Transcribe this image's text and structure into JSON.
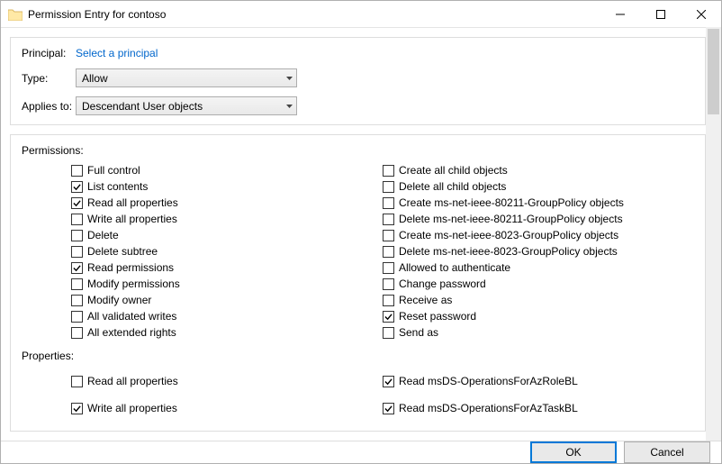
{
  "window": {
    "title": "Permission Entry for contoso"
  },
  "header": {
    "principal_label": "Principal:",
    "principal_link": "Select a principal",
    "type_label": "Type:",
    "type_value": "Allow",
    "applies_label": "Applies to:",
    "applies_value": "Descendant User objects"
  },
  "permissions_label": "Permissions:",
  "perms_left": [
    {
      "label": "Full control",
      "checked": false
    },
    {
      "label": "List contents",
      "checked": true
    },
    {
      "label": "Read all properties",
      "checked": true
    },
    {
      "label": "Write all properties",
      "checked": false
    },
    {
      "label": "Delete",
      "checked": false
    },
    {
      "label": "Delete subtree",
      "checked": false
    },
    {
      "label": "Read permissions",
      "checked": true
    },
    {
      "label": "Modify permissions",
      "checked": false
    },
    {
      "label": "Modify owner",
      "checked": false
    },
    {
      "label": "All validated writes",
      "checked": false
    },
    {
      "label": "All extended rights",
      "checked": false
    }
  ],
  "perms_right": [
    {
      "label": "Create all child objects",
      "checked": false
    },
    {
      "label": "Delete all child objects",
      "checked": false
    },
    {
      "label": "Create ms-net-ieee-80211-GroupPolicy objects",
      "checked": false
    },
    {
      "label": "Delete ms-net-ieee-80211-GroupPolicy objects",
      "checked": false
    },
    {
      "label": "Create ms-net-ieee-8023-GroupPolicy objects",
      "checked": false
    },
    {
      "label": "Delete ms-net-ieee-8023-GroupPolicy objects",
      "checked": false
    },
    {
      "label": "Allowed to authenticate",
      "checked": false
    },
    {
      "label": "Change password",
      "checked": false
    },
    {
      "label": "Receive as",
      "checked": false
    },
    {
      "label": "Reset password",
      "checked": true
    },
    {
      "label": "Send as",
      "checked": false
    }
  ],
  "properties_label": "Properties:",
  "props_left": [
    {
      "label": "Read all properties",
      "checked": false
    },
    {
      "label": "Write all properties",
      "checked": true
    }
  ],
  "props_right": [
    {
      "label": "Read msDS-OperationsForAzRoleBL",
      "checked": true
    },
    {
      "label": "Read msDS-OperationsForAzTaskBL",
      "checked": true
    }
  ],
  "footer": {
    "ok": "OK",
    "cancel": "Cancel"
  }
}
